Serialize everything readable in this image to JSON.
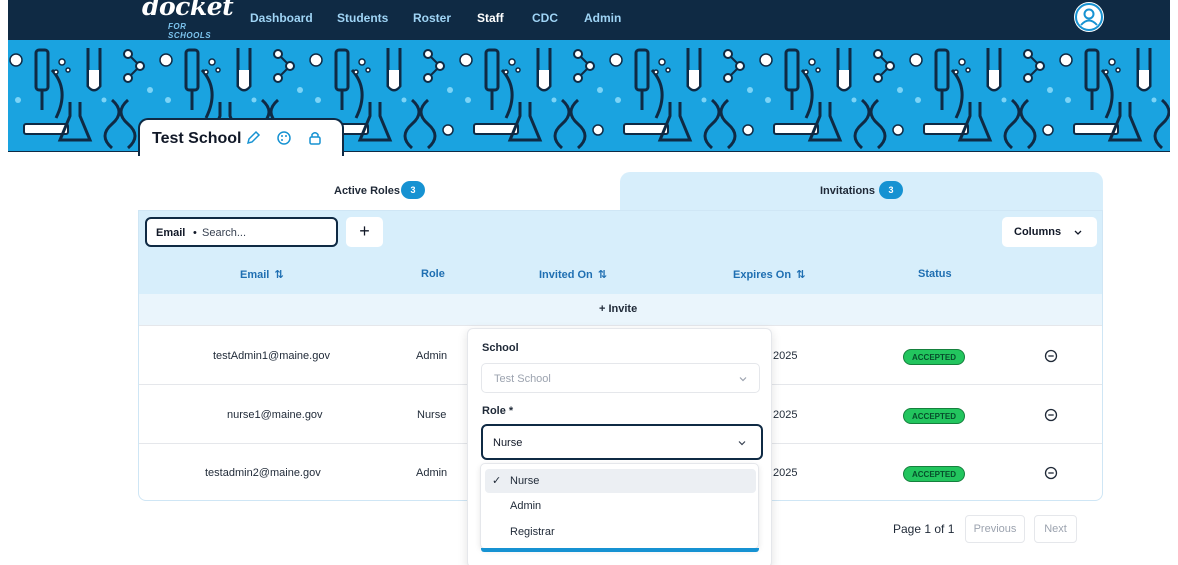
{
  "nav": {
    "logo_main": "docket",
    "logo_sub": "FOR SCHOOLS",
    "links": [
      "Dashboard",
      "Students",
      "Roster",
      "Staff",
      "CDC",
      "Admin"
    ],
    "active": "Staff"
  },
  "school": {
    "name": "Test School"
  },
  "tabs": [
    {
      "label": "Active Roles",
      "count": "3"
    },
    {
      "label": "Invitations",
      "count": "3"
    }
  ],
  "toolbar": {
    "search_prefix": "Email",
    "search_dot": "•",
    "search_placeholder": "Search...",
    "add_label": "+",
    "columns_label": "Columns"
  },
  "table": {
    "headers": [
      "Email",
      "Role",
      "Invited On",
      "Expires On",
      "Status"
    ],
    "invite_label": "+ Invite",
    "rows": [
      {
        "email": "testAdmin1@maine.gov",
        "role": "Admin",
        "expires": "2025",
        "status": "ACCEPTED"
      },
      {
        "email": "nurse1@maine.gov",
        "role": "Nurse",
        "expires": "2025",
        "status": "ACCEPTED"
      },
      {
        "email": "testadmin2@maine.gov",
        "role": "Admin",
        "expires": "2025",
        "status": "ACCEPTED"
      }
    ]
  },
  "pagination": {
    "info": "Page 1 of 1",
    "previous": "Previous",
    "next": "Next"
  },
  "form": {
    "school_label": "School",
    "school_value": "Test School",
    "role_label": "Role *",
    "role_value": "Nurse",
    "role_options": [
      "Nurse",
      "Admin",
      "Registrar"
    ],
    "selected_option": "Nurse",
    "check": "✓"
  },
  "colors": {
    "nav_bg": "#0f2a44",
    "banner_bg": "#1aa3e0",
    "accent": "#1692d2",
    "status_green": "#22c55e"
  }
}
